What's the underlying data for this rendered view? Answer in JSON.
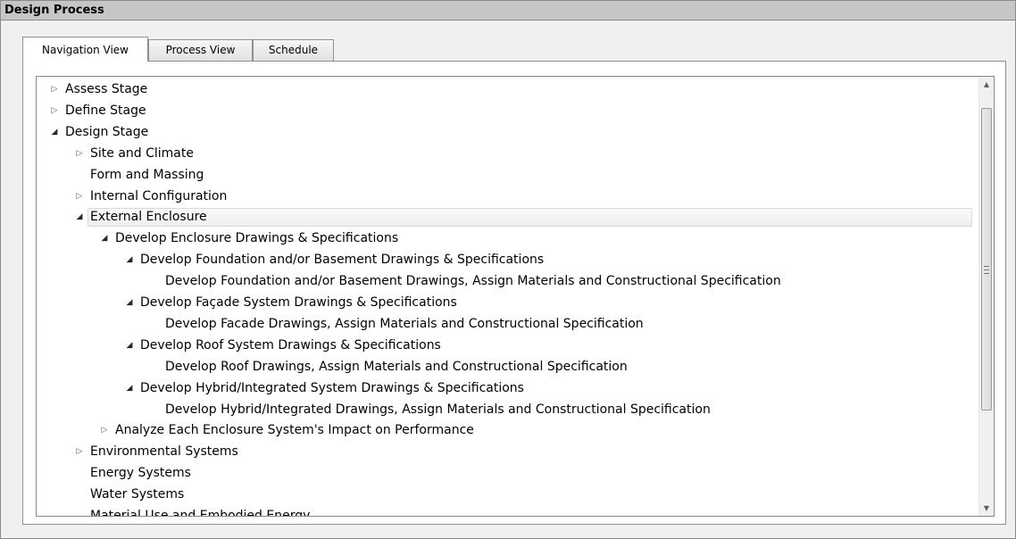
{
  "window": {
    "title": "Design Process"
  },
  "tabs": [
    {
      "label": "Navigation View",
      "active": true
    },
    {
      "label": "Process View",
      "active": false
    },
    {
      "label": "Schedule",
      "active": false
    }
  ],
  "tree": {
    "nodes": [
      {
        "label": "Assess Stage",
        "level": 0,
        "expander": "collapsed"
      },
      {
        "label": "Define Stage",
        "level": 0,
        "expander": "collapsed"
      },
      {
        "label": "Design Stage",
        "level": 0,
        "expander": "expanded"
      },
      {
        "label": "Site and Climate",
        "level": 1,
        "expander": "collapsed"
      },
      {
        "label": "Form and Massing",
        "level": 1,
        "expander": "none"
      },
      {
        "label": "Internal Configuration",
        "level": 1,
        "expander": "collapsed"
      },
      {
        "label": "External Enclosure",
        "level": 1,
        "expander": "expanded",
        "selected": true
      },
      {
        "label": "Develop Enclosure Drawings & Specifications",
        "level": 2,
        "expander": "expanded"
      },
      {
        "label": "Develop Foundation and/or Basement Drawings & Specifications",
        "level": 3,
        "expander": "expanded"
      },
      {
        "label": "Develop Foundation and/or Basement Drawings, Assign Materials and Constructional Specification",
        "level": 4,
        "expander": "none"
      },
      {
        "label": "Develop Façade System Drawings & Specifications",
        "level": 3,
        "expander": "expanded"
      },
      {
        "label": "Develop Facade Drawings, Assign Materials and Constructional Specification",
        "level": 4,
        "expander": "none"
      },
      {
        "label": "Develop Roof System Drawings & Specifications",
        "level": 3,
        "expander": "expanded"
      },
      {
        "label": "Develop Roof Drawings, Assign Materials and Constructional Specification",
        "level": 4,
        "expander": "none"
      },
      {
        "label": "Develop Hybrid/Integrated System Drawings & Specifications",
        "level": 3,
        "expander": "expanded"
      },
      {
        "label": "Develop Hybrid/Integrated Drawings, Assign Materials and Constructional Specification",
        "level": 4,
        "expander": "none"
      },
      {
        "label": "Analyze Each Enclosure System's Impact on Performance",
        "level": 2,
        "expander": "collapsed"
      },
      {
        "label": "Environmental Systems",
        "level": 1,
        "expander": "collapsed"
      },
      {
        "label": "Energy Systems",
        "level": 1,
        "expander": "none"
      },
      {
        "label": "Water Systems",
        "level": 1,
        "expander": "none"
      },
      {
        "label": "Material Use and Embodied Energy",
        "level": 1,
        "expander": "none"
      }
    ]
  },
  "icons": {
    "collapsed": "tree-collapsed-triangle-icon",
    "expanded": "tree-expanded-triangle-icon",
    "scroll_up": "scroll-up-arrow-icon",
    "scroll_down": "scroll-down-arrow-icon"
  },
  "scrollbar": {
    "thumb_start": 0.04,
    "thumb_fraction": 0.74
  }
}
